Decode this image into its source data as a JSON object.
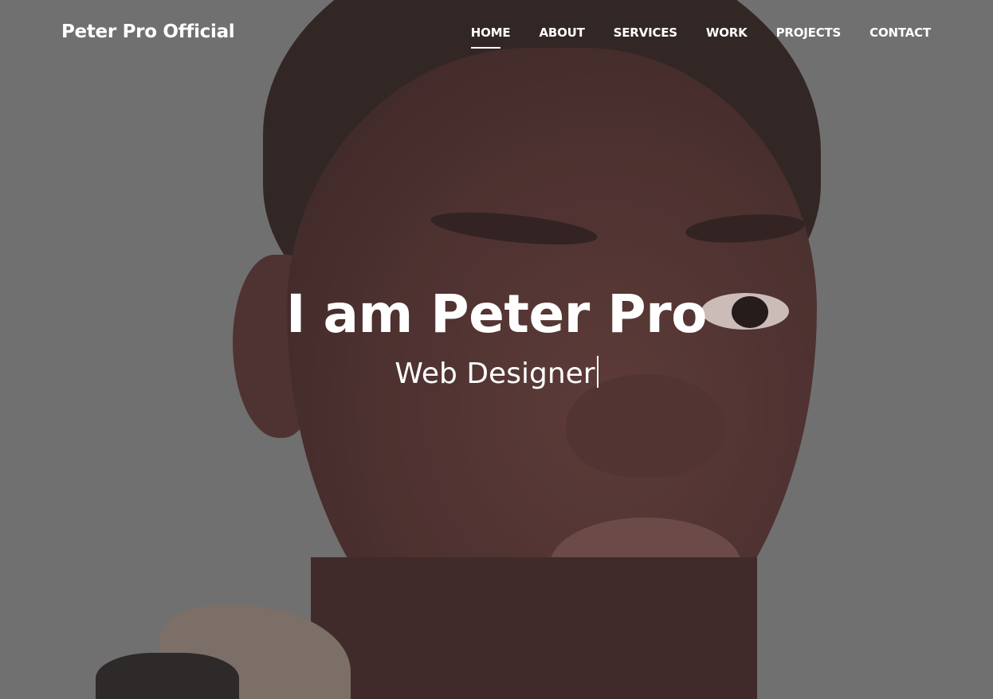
{
  "brand": {
    "name": "Peter Pro Official"
  },
  "nav": {
    "items": [
      {
        "label": "HOME",
        "active": true
      },
      {
        "label": "ABOUT",
        "active": false
      },
      {
        "label": "SERVICES",
        "active": false
      },
      {
        "label": "WORK",
        "active": false
      },
      {
        "label": "PROJECTS",
        "active": false
      },
      {
        "label": "CONTACT",
        "active": false
      }
    ]
  },
  "hero": {
    "title": "I am Peter Pro",
    "typed_text": "Web Designer"
  },
  "colors": {
    "text": "#ffffff",
    "background_overlay": "#707070"
  },
  "icons": {
    "cursor": "text-caret-icon"
  }
}
